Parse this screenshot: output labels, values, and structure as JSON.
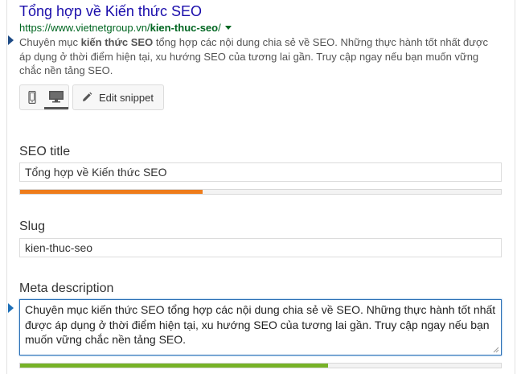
{
  "snippet": {
    "title": "Tổng hợp về Kiến thức SEO",
    "url_base": "https://www.vietnetgroup.vn/",
    "url_slug": "kien-thuc-seo",
    "url_suffix": "/",
    "desc_before": "Chuyên mục ",
    "desc_keyword": "kiến thức SEO",
    "desc_after": " tổng hợp các nội dung chia sẻ về SEO. Những thực hành tốt nhất được áp dụng ở thời điểm hiện tại, xu hướng SEO của tương lai gần. Truy cập ngay nếu bạn muốn vững chắc nền tảng SEO."
  },
  "toolbar": {
    "mobile_icon": "mobile-icon",
    "desktop_icon": "desktop-icon",
    "edit_label": "Edit snippet",
    "edit_icon": "pencil-icon"
  },
  "seo_title": {
    "label": "SEO title",
    "value": "Tổng hợp về Kiến thức SEO",
    "progress": 0.38,
    "color": "#ee7c1b"
  },
  "slug": {
    "label": "Slug",
    "value": "kien-thuc-seo"
  },
  "meta_description": {
    "label": "Meta description",
    "value": "Chuyên mục kiến thức SEO tổng hợp các nội dung chia sẻ về SEO. Những thực hành tốt nhất được áp dụng ở thời điểm hiện tại, xu hướng SEO của tương lai gần. Truy cập ngay nếu bạn muốn vững chắc nền tảng SEO.",
    "progress": 0.64,
    "color": "#77b227"
  },
  "colors": {
    "title_link": "#1a0dab",
    "url": "#006621",
    "accent": "#1e4b86"
  }
}
